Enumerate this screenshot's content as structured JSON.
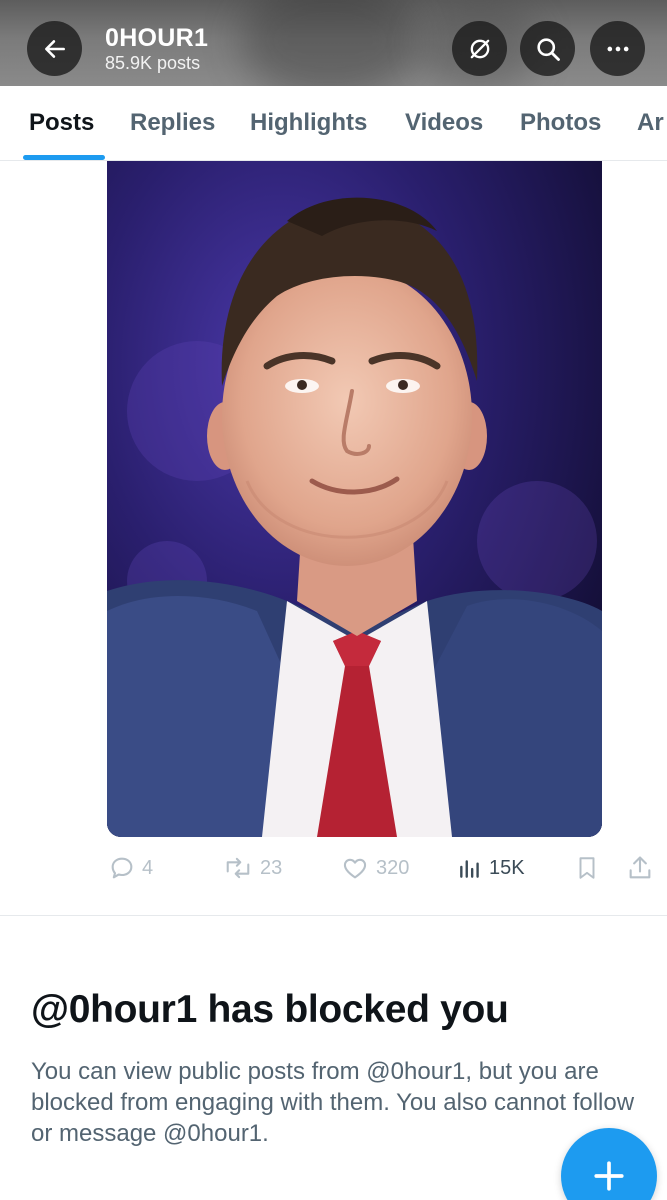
{
  "header": {
    "title": "0HOUR1",
    "subtitle": "85.9K posts",
    "icons": [
      "arrow-left-icon",
      "unlock-icon",
      "search-icon",
      "more-icon"
    ]
  },
  "tabs": [
    {
      "label": "Posts",
      "active": true
    },
    {
      "label": "Replies",
      "active": false
    },
    {
      "label": "Highlights",
      "active": false
    },
    {
      "label": "Videos",
      "active": false
    },
    {
      "label": "Photos",
      "active": false
    },
    {
      "label": "Ar",
      "active": false
    }
  ],
  "post": {
    "image_alt": "photo of a man in a suit and red tie",
    "replies": "4",
    "reposts": "23",
    "likes": "320",
    "views": "15K"
  },
  "blocked": {
    "title": "@0hour1 has blocked you",
    "body": "You can view public posts from @0hour1, but you are blocked from engaging with them. You also cannot follow or message @0hour1."
  },
  "colors": {
    "accent": "#1d9bf0",
    "text_primary": "#0f1419",
    "text_secondary": "#536471"
  }
}
